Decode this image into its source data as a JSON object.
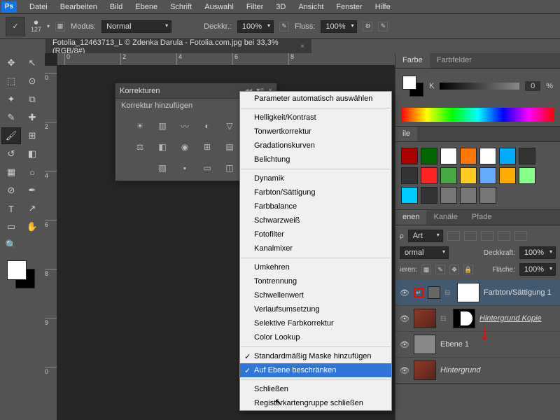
{
  "menubar": [
    "Datei",
    "Bearbeiten",
    "Bild",
    "Ebene",
    "Schrift",
    "Auswahl",
    "Filter",
    "3D",
    "Ansicht",
    "Fenster",
    "Hilfe"
  ],
  "optbar": {
    "size": "127",
    "mode_lbl": "Modus:",
    "mode": "Normal",
    "opacity_lbl": "Deckkr.:",
    "opacity": "100%",
    "flow_lbl": "Fluss:",
    "flow": "100%"
  },
  "doc": {
    "title": "Fotolia_12463713_L © Zdenka Darula - Fotolia.com.jpg bei 33,3% (RGB/8#)"
  },
  "corrections": {
    "title": "Korrekturen",
    "subtitle": "Korrektur hinzufügen"
  },
  "context": {
    "groups": [
      [
        "Parameter automatisch auswählen"
      ],
      [
        "Helligkeit/Kontrast",
        "Tonwertkorrektur",
        "Gradationskurven",
        "Belichtung"
      ],
      [
        "Dynamik",
        "Farbton/Sättigung",
        "Farbbalance",
        "Schwarzweiß",
        "Fotofilter",
        "Kanalmixer"
      ],
      [
        "Umkehren",
        "Tontrennung",
        "Schwellenwert",
        "Verlaufsumsetzung",
        "Selektive Farbkorrektur",
        "Color Lookup"
      ]
    ],
    "checks": [
      "Standardmäßig Maske hinzufügen",
      "Auf Ebene beschränken"
    ],
    "footer": [
      "Schließen",
      "Registerkartengruppe schließen"
    ]
  },
  "panels": {
    "color": {
      "tabs": [
        "Farbe",
        "Farbfelder"
      ],
      "k": "K",
      "val": "0",
      "pct": "%"
    },
    "styles_tab": "ile",
    "layers": {
      "tabs": [
        "enen",
        "Kanäle",
        "Pfade"
      ],
      "filter": "Art",
      "mode": "ormal",
      "opacity_lbl": "Deckkraft:",
      "opacity": "100%",
      "lock_lbl": "ieren:",
      "fill_lbl": "Fläche:",
      "fill": "100%",
      "items": [
        {
          "name": "Farbton/Sättigung 1"
        },
        {
          "name": "Hintergrund Kopie"
        },
        {
          "name": "Ebene 1"
        },
        {
          "name": "Hintergrund"
        }
      ]
    }
  },
  "ruler_h": [
    "0",
    "2",
    "4",
    "6",
    "8"
  ],
  "ruler_v": [
    "0",
    "2",
    "4",
    "6",
    "8",
    "9",
    "0"
  ],
  "styles_colors": [
    "#a00",
    "#060",
    "#fff",
    "#f70",
    "#fff",
    "#0af",
    "#333",
    "#333",
    "#f22",
    "#4a4",
    "#fc2",
    "#6af",
    "#fa0",
    "#8f8",
    "#0cf",
    "#333",
    "#777",
    "#777",
    "#777"
  ]
}
